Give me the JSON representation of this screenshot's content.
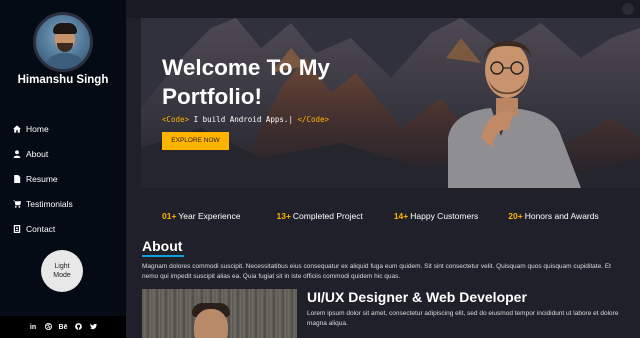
{
  "sidebar": {
    "name": "Himanshu Singh",
    "nav": [
      {
        "label": "Home",
        "icon": "home-icon"
      },
      {
        "label": "About",
        "icon": "user-icon"
      },
      {
        "label": "Resume",
        "icon": "file-icon"
      },
      {
        "label": "Testimonials",
        "icon": "cart-icon"
      },
      {
        "label": "Contact",
        "icon": "contact-icon"
      }
    ],
    "mode_button": "Light\nMode",
    "social": [
      "in",
      "dribbble",
      "Bē",
      "github",
      "twitter"
    ],
    "social_text": {
      "linkedin": "in",
      "behance": "Bē"
    }
  },
  "hero": {
    "title": "Welcome To My Portfolio!",
    "sub_open": "<Code>",
    "sub_text": " I build Android Apps.",
    "sub_close": "</Code>",
    "cursor": "|",
    "explore": "EXPLORE NOW"
  },
  "stats": [
    {
      "num": "01+",
      "label": "Year Experience"
    },
    {
      "num": "13+",
      "label": "Completed Project"
    },
    {
      "num": "14+",
      "label": "Happy Customers"
    },
    {
      "num": "20+",
      "label": "Honors and Awards"
    }
  ],
  "about": {
    "title": "About",
    "text": "Magnam dolores commodi suscipit. Necessitatibus eius consequatur ex aliquid fuga eum quidem. Sit sint consectetur velit. Quisquam quos quisquam cupiditate. Et nemo qui impedit suscipit alias ea. Quia fugiat sit in iste officiis commodi quidem hic quas.",
    "role": "UI/UX Designer & Web Developer",
    "role_text": "Lorem ipsum dolor sit amet, consectetur adipiscing elit, sed do eiusmod tempor incididunt ut labore et dolore magna aliqua."
  },
  "colors": {
    "accent": "#ffb400",
    "underline": "#149ddd",
    "sidebar_bg": "#040b14",
    "page_bg": "#1f2029"
  }
}
